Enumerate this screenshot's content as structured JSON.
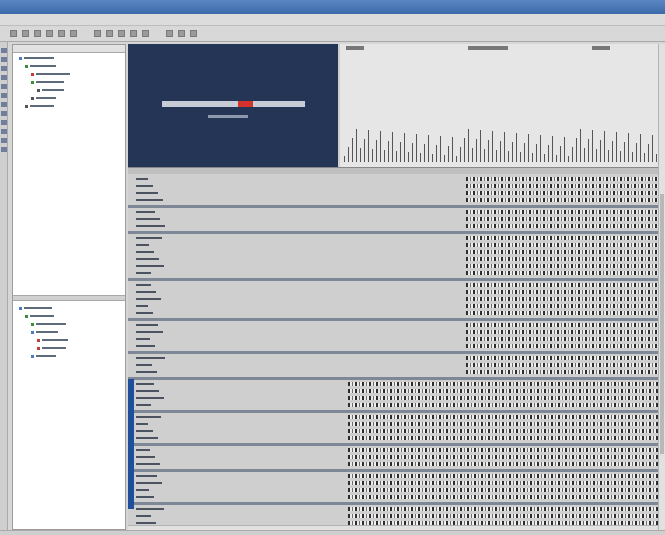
{
  "app": {
    "title": "",
    "colors": {
      "titlebar": "#3d6aa8",
      "banner": "#253555",
      "accent_red": "#d4342c",
      "row_highlight": "#1f4e9b"
    }
  },
  "toolbar": {
    "icons": [
      "new-icon",
      "open-icon",
      "save-icon",
      "print-icon",
      "cut-icon",
      "copy-icon",
      "paste-icon",
      "undo-icon",
      "redo-icon",
      "find-icon",
      "zoom-icon",
      "refresh-icon",
      "settings-icon",
      "help-icon"
    ]
  },
  "banner": {
    "title": "",
    "subtitle": ""
  },
  "grid": {
    "column_headers": [
      "",
      "",
      ""
    ]
  }
}
